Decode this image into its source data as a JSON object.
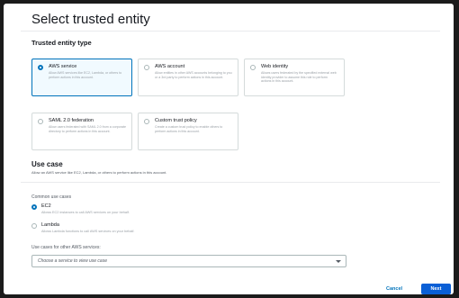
{
  "page": {
    "title": "Select trusted entity"
  },
  "trusted_entity": {
    "heading": "Trusted entity type",
    "options": [
      {
        "title": "AWS service",
        "description": "Allow AWS services like EC2, Lambda, or others to perform actions in this account.",
        "selected": true
      },
      {
        "title": "AWS account",
        "description": "Allow entities in other AWS accounts belonging to you or a 3rd party to perform actions in this account.",
        "selected": false
      },
      {
        "title": "Web identity",
        "description": "Allows users federated by the specified external web identity provider to assume this role to perform actions in this account.",
        "selected": false
      },
      {
        "title": "SAML 2.0 federation",
        "description": "Allow users federated with SAML 2.0 from a corporate directory to perform actions in this account.",
        "selected": false
      },
      {
        "title": "Custom trust policy",
        "description": "Create a custom trust policy to enable others to perform actions in this account.",
        "selected": false
      }
    ]
  },
  "use_case": {
    "heading": "Use case",
    "subtitle": "Allow an AWS service like EC2, Lambda, or others to perform actions in this account.",
    "common_label": "Common use cases",
    "options": [
      {
        "title": "EC2",
        "description": "Allows EC2 instances to call AWS services on your behalf.",
        "selected": true
      },
      {
        "title": "Lambda",
        "description": "Allows Lambda functions to call AWS services on your behalf.",
        "selected": false
      }
    ],
    "other_label": "Use cases for other AWS services:",
    "select_placeholder": "Choose a service to view use case"
  },
  "footer": {
    "cancel_label": "Cancel",
    "next_label": "Next"
  },
  "colors": {
    "accent": "#0073bb",
    "primary_button": "#0a5fd6"
  }
}
